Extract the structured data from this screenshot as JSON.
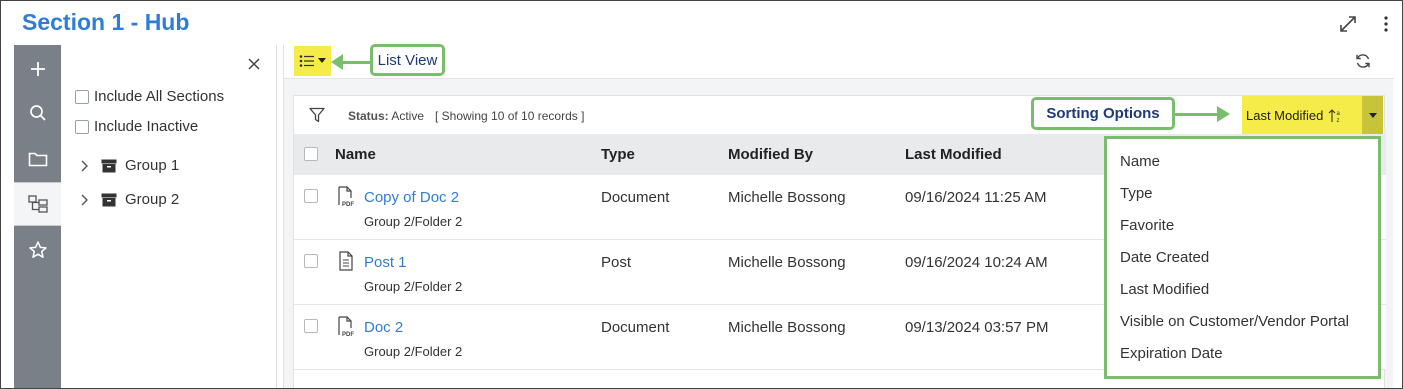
{
  "title": "Section 1 - Hub",
  "rail": [
    "plus-icon",
    "search-icon",
    "folder-icon",
    "tree-icon",
    "star-icon"
  ],
  "tree_panel": {
    "include_all": "Include All Sections",
    "include_inactive": "Include Inactive",
    "groups": [
      "Group 1",
      "Group 2"
    ]
  },
  "callouts": {
    "list_view": "List View",
    "sorting": "Sorting Options"
  },
  "status": {
    "label": "Status:",
    "value": "Active",
    "records": "[ Showing 10 of 10 records ]"
  },
  "sort": {
    "current": "Last Modified",
    "options": [
      "Name",
      "Type",
      "Favorite",
      "Date Created",
      "Last Modified",
      "Visible on Customer/Vendor Portal",
      "Expiration Date"
    ]
  },
  "table": {
    "headers": [
      "Name",
      "Type",
      "Modified By",
      "Last Modified"
    ],
    "rows": [
      {
        "name": "Copy of Doc 2",
        "path": "Group 2/Folder 2",
        "type": "Document",
        "modified_by": "Michelle Bossong",
        "last_modified": "09/16/2024 11:25 AM",
        "icon": "pdf-file-icon"
      },
      {
        "name": "Post 1",
        "path": "Group 2/Folder 2",
        "type": "Post",
        "modified_by": "Michelle Bossong",
        "last_modified": "09/16/2024 10:24 AM",
        "icon": "post-file-icon"
      },
      {
        "name": "Doc 2",
        "path": "Group 2/Folder 2",
        "type": "Document",
        "modified_by": "Michelle Bossong",
        "last_modified": "09/13/2024 03:57 PM",
        "icon": "pdf-file-icon"
      }
    ]
  },
  "colors": {
    "title_blue": "#2f7dd6",
    "highlight_yellow": "#f5ec4a",
    "callout_green": "#79be6d",
    "rail_gray": "#7a8087"
  }
}
